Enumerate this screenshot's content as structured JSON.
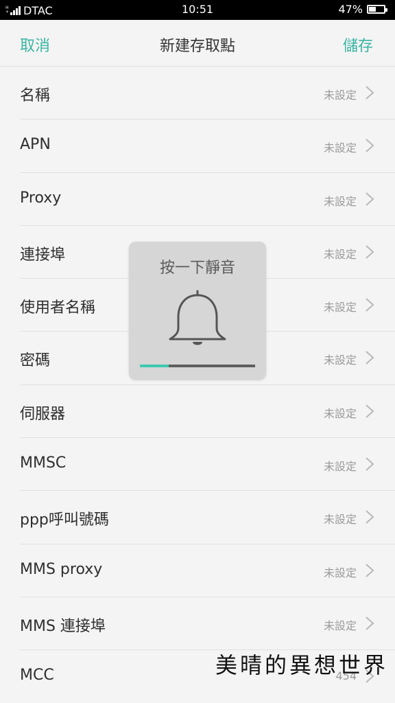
{
  "status_bar": {
    "network": "H+",
    "carrier": "DTAC",
    "time": "10:51",
    "battery": "47%",
    "battery_level": 0.47
  },
  "header": {
    "cancel_label": "取消",
    "title": "新建存取點",
    "save_label": "儲存",
    "accent_color": "#3ab5a3"
  },
  "rows": [
    {
      "label": "名稱",
      "value": "未設定"
    },
    {
      "label": "APN",
      "value": "未設定"
    },
    {
      "label": "Proxy",
      "value": "未設定"
    },
    {
      "label": "連接埠",
      "value": "未設定"
    },
    {
      "label": "使用者名稱",
      "value": "未設定"
    },
    {
      "label": "密碼",
      "value": "未設定"
    },
    {
      "label": "伺服器",
      "value": "未設定"
    },
    {
      "label": "MMSC",
      "value": "未設定"
    },
    {
      "label": "ppp呼叫號碼",
      "value": "未設定"
    },
    {
      "label": "MMS proxy",
      "value": "未設定"
    },
    {
      "label": "MMS 連接埠",
      "value": "未設定"
    },
    {
      "label": "MCC",
      "value": "454"
    }
  ],
  "toast": {
    "text": "按一下靜音",
    "icon": "bell-icon",
    "volume_level": 0.25,
    "volume_color": "#3ec9b1"
  },
  "watermark": "美晴的異想世界"
}
